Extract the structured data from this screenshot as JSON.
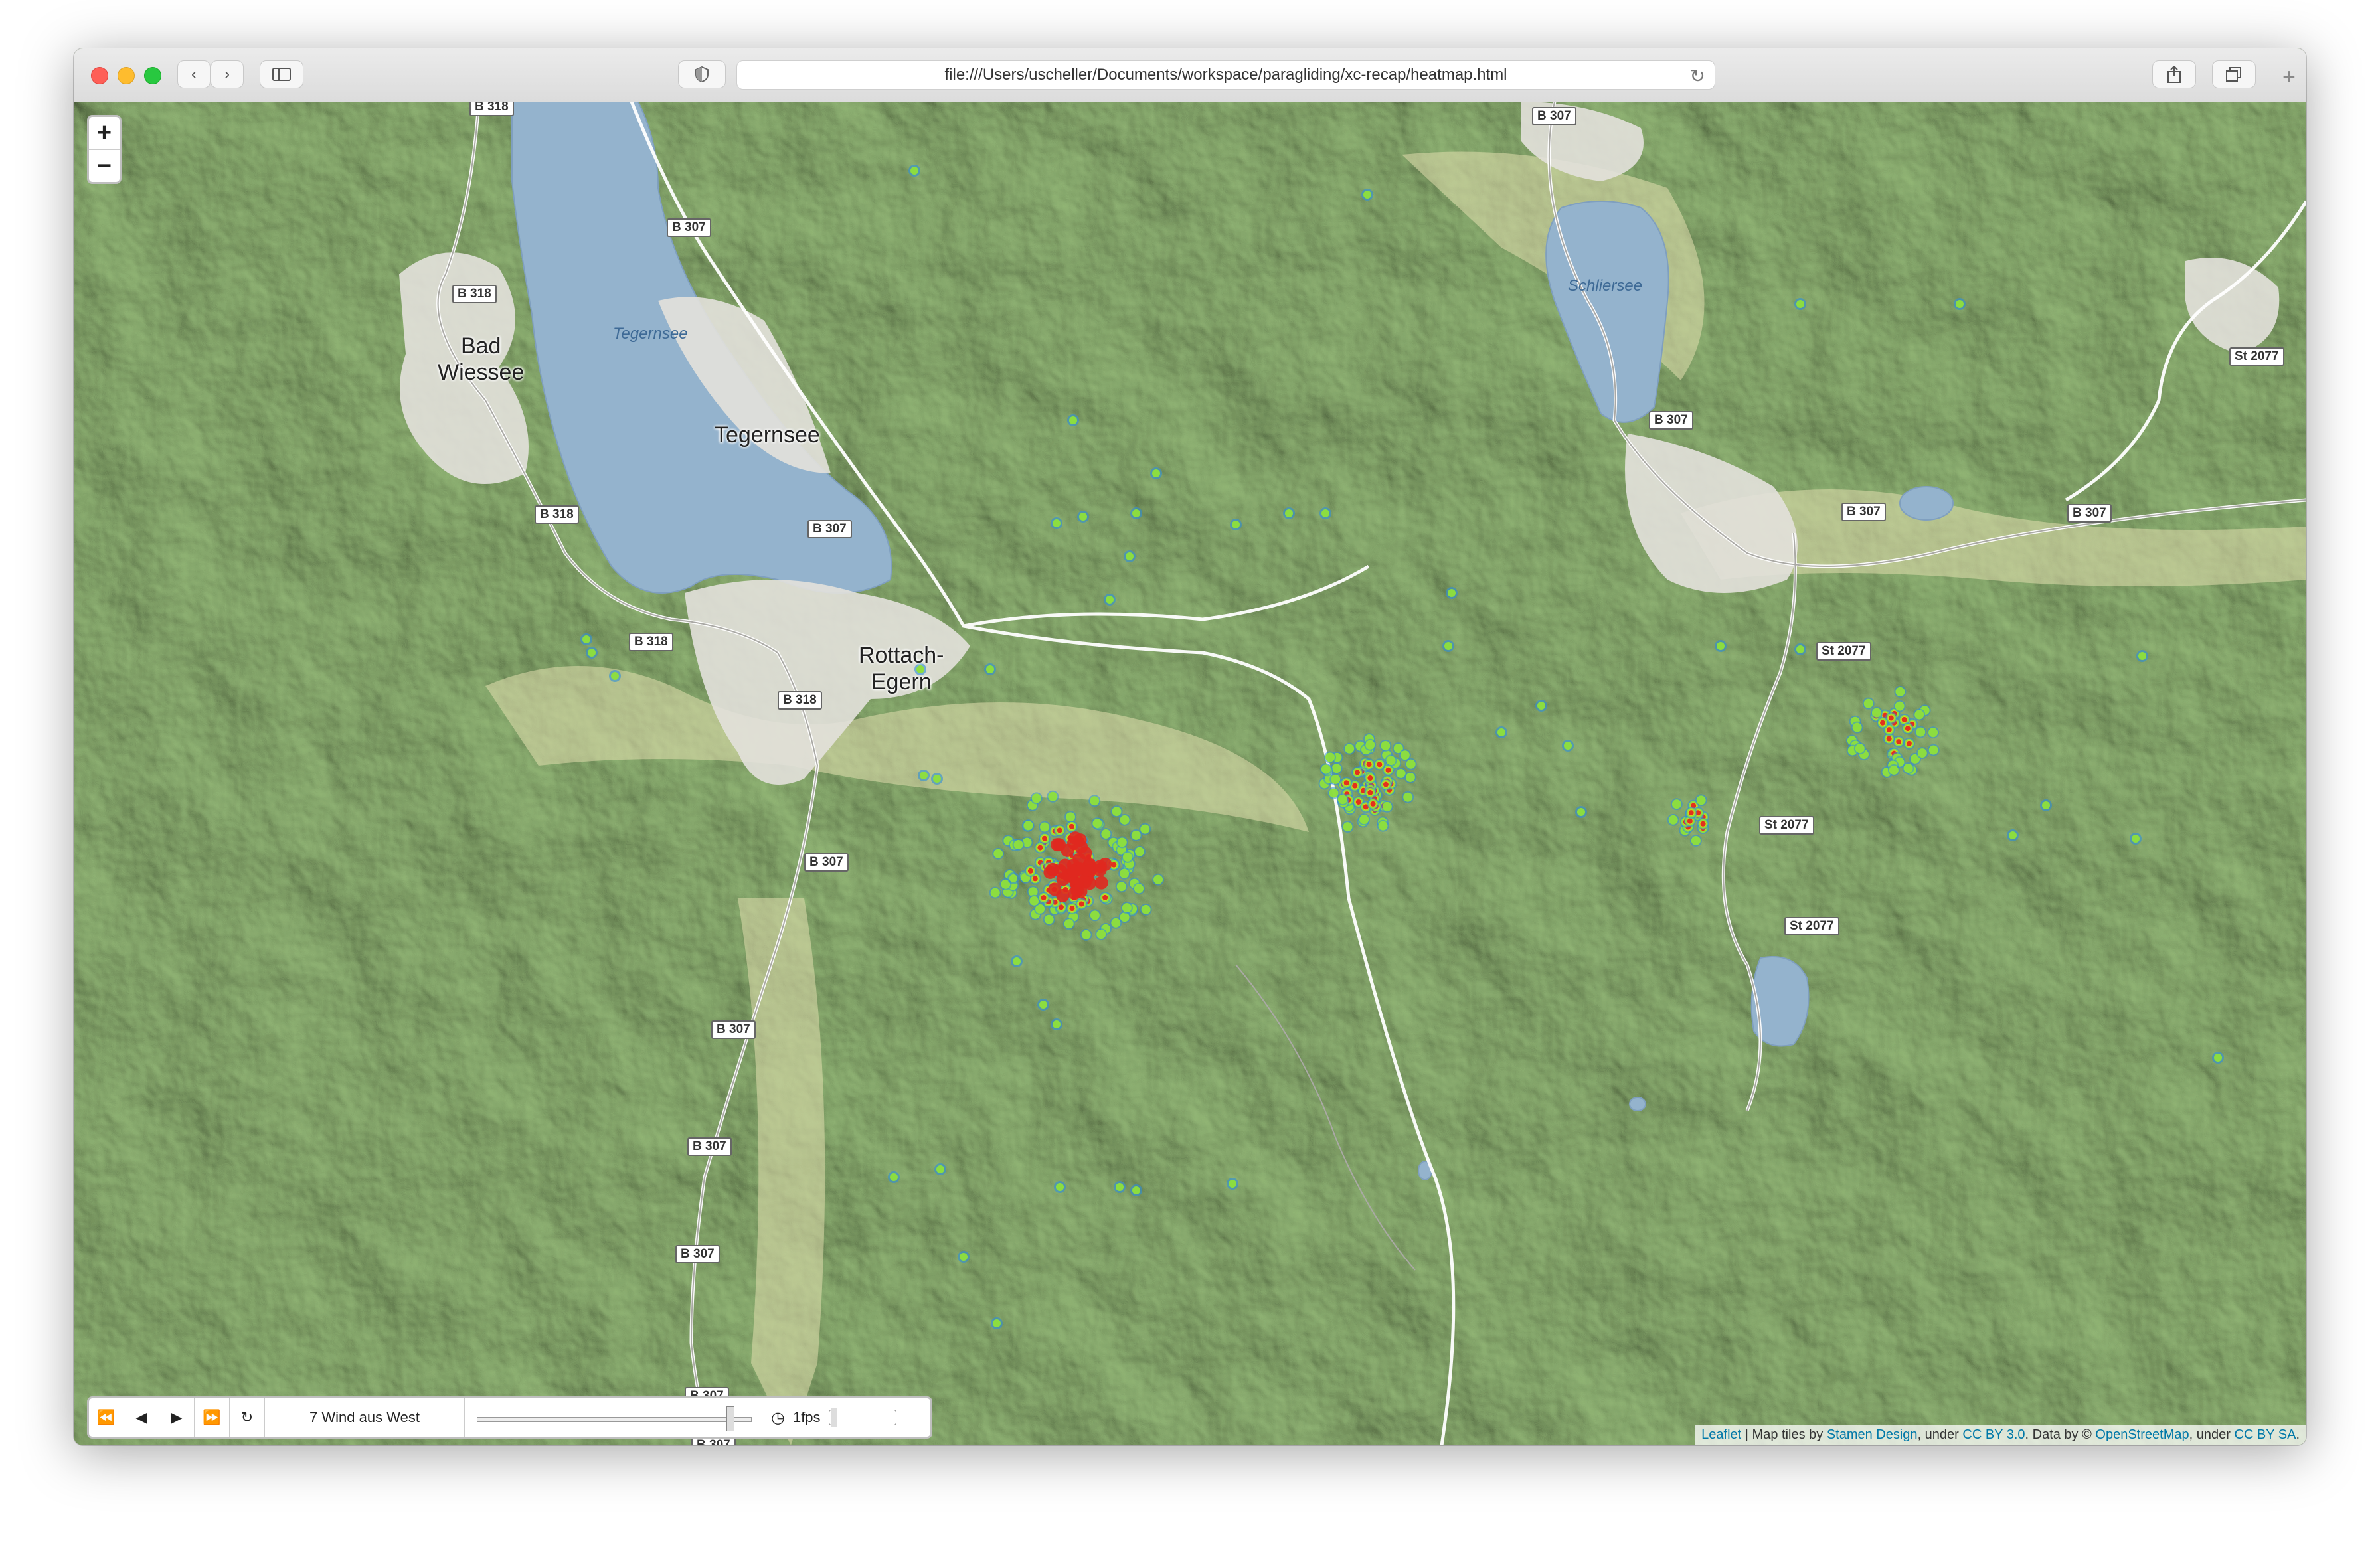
{
  "browser": {
    "url": "file:///Users/uscheller/Documents/workspace/paragliding/xc-recap/heatmap.html"
  },
  "map": {
    "zoom_in": "+",
    "zoom_out": "−",
    "place_labels": [
      {
        "id": "bad-wiessee",
        "text": "Bad\nWiessee"
      },
      {
        "id": "tegernsee-town",
        "text": "Tegernsee"
      },
      {
        "id": "rottach-egern",
        "text": "Rottach-\nEgern"
      }
    ],
    "lake_labels": [
      {
        "id": "tegernsee-lake",
        "text": "Tegernsee"
      },
      {
        "id": "schliersee-lake",
        "text": "Schliersee"
      }
    ],
    "road_labels": [
      "B 318",
      "B 307",
      "B 318",
      "B 318",
      "B 307",
      "B 318",
      "B 318",
      "B 307",
      "B 307",
      "B 307",
      "B 307",
      "B 307",
      "B 307",
      "B 307",
      "B 307",
      "St 2077",
      "B 307",
      "B 307",
      "St 2077",
      "St 2077",
      "St 2077",
      "B 307"
    ],
    "heat_colors": {
      "low": "#2f8fd8",
      "mid": "#8fe03a",
      "high": "#e8d21a",
      "peak": "#e0281f"
    }
  },
  "timeline": {
    "label": "7 Wind aus West",
    "fps": "1fps",
    "position": 0.93
  },
  "attribution": {
    "leaflet": "Leaflet",
    "sep1": " | Map tiles by ",
    "stamen": "Stamen Design",
    "sep2": ", under ",
    "cc30": "CC BY 3.0",
    "sep3": ". Data by © ",
    "osm": "OpenStreetMap",
    "sep4": ", under ",
    "ccbysa": "CC BY SA",
    "end": "."
  }
}
